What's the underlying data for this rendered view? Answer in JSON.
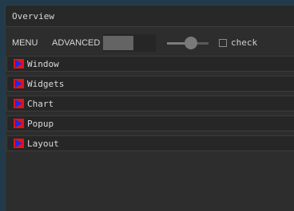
{
  "window": {
    "title": "Overview"
  },
  "menubar": {
    "menu_label": "MENU",
    "advanced_label": "ADVANCED",
    "slider_value": 0.58,
    "checkbox_label": "check",
    "checkbox_checked": false
  },
  "sections": [
    {
      "label": "Window",
      "icon": "play-triangle-icon"
    },
    {
      "label": "Widgets",
      "icon": "play-triangle-icon"
    },
    {
      "label": "Chart",
      "icon": "play-triangle-icon"
    },
    {
      "label": "Popup",
      "icon": "play-triangle-icon"
    },
    {
      "label": "Layout",
      "icon": "play-triangle-icon"
    }
  ],
  "colors": {
    "icon_background": "#e3131b",
    "icon_triangle": "#1f2be0",
    "desktop": "#213b4b",
    "window": "#2d2d2d"
  }
}
